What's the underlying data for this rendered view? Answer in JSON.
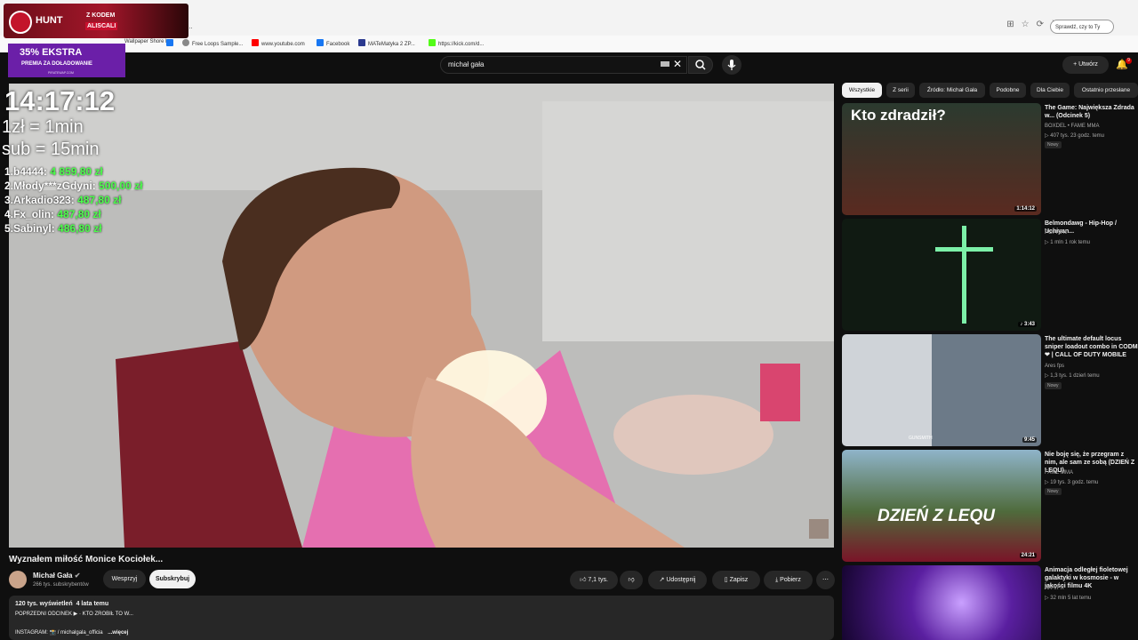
{
  "browser": {
    "address": "...",
    "search_label": "Sprawdź, czy to Ty",
    "bookmarks": [
      "Wallpaper Shore l...",
      "Free Loops Sample...",
      "www.youtube.com",
      "Facebook",
      "MATeMatyka 2 ZP...",
      "https://kick.com/d..."
    ]
  },
  "overlay": {
    "hunt_label": "HUNT",
    "hunt_code_prefix": "Z KODEM",
    "hunt_code": "ALISCALI",
    "promo_title": "35% EKSTRA",
    "promo_sub": "PREMIA ZA DOŁADOWANIE",
    "promo_url": "PIRATEWAP.COM",
    "clock": "14:17:12",
    "rate_1": "1zł = 1min",
    "rate_2": "sub = 15min",
    "leaderboard": [
      {
        "rank": "1.",
        "name": "b4444:",
        "amount": "4 859,80 zł"
      },
      {
        "rank": "2.",
        "name": "Młody***zGdyni:",
        "amount": "500,00 zł"
      },
      {
        "rank": "3.",
        "name": "Arkadio323:",
        "amount": "487,80 zł"
      },
      {
        "rank": "4.",
        "name": "Fx_olin:",
        "amount": "487,80 zł"
      },
      {
        "rank": "5.",
        "name": "Sabinyl:",
        "amount": "486,80 zł"
      }
    ]
  },
  "header": {
    "search_value": "michał gała",
    "create_label": "Utwórz",
    "notifications_badge": "9"
  },
  "video": {
    "title": "Wyznałem miłość Monice Kociołek...",
    "channel": "Michał Gała",
    "subscribers": "266 tys. subskrybentów",
    "support_label": "Wesprzyj",
    "subscribe_label": "Subskrybuj",
    "likes": "7,1 tys.",
    "share_label": "Udostępnij",
    "save_label": "Zapisz",
    "download_label": "Pobierz",
    "views": "120 tys. wyświetleń",
    "age": "4 lata temu",
    "desc_line": "POPRZEDNI ODCINEK ▶ · KTO ZROBIŁ TO W...",
    "instagram": "INSTAGRAM: 📸 / michalgala_officia",
    "more": "...więcej"
  },
  "chips": [
    "Wszystkie",
    "Z serii",
    "Źródło: Michał Gała",
    "Podobne",
    "Dla Ciebie",
    "Ostatnio przesłane"
  ],
  "recommendations": [
    {
      "title": "The Game: Największa Zdrada w... (Odcinek 5)",
      "channel": "BOXDEL • FAME MMA",
      "meta": "▷ 407 tys.  23 godz. temu",
      "badge": "Nowy",
      "duration": "1:14:12",
      "thumb_text": "Kto zdradził?"
    },
    {
      "title": "Belmondawg - Hip-Hop / Uchiyan...",
      "channel": "POPPYN",
      "meta": "▷ 1 mln  1 rok temu",
      "badge": "",
      "duration": "3:43",
      "thumb_text": ""
    },
    {
      "title": "The ultimate default locus sniper loadout combo in CODM ❤ | CALL OF DUTY MOBILE",
      "channel": "Ares fps",
      "meta": "▷ 1,3 tys.  1 dzień temu",
      "badge": "Nowy",
      "duration": "9:45",
      "thumb_text": "GUNSMITH"
    },
    {
      "title": "Nie boję się, że przegram z nim, ale sam ze sobą (DZIEŃ Z LEQU)",
      "channel": "FAME MMA",
      "meta": "▷ 19 tys.  3 godz. temu",
      "badge": "Nowy",
      "duration": "24:21",
      "thumb_text": "DZIEŃ Z LEQU"
    },
    {
      "title": "Animacja odległej fioletowej galaktyki w kosmosie - w jakości filmu 4K",
      "channel": "AA-VFX",
      "meta": "▷ 32 mln  5 lat temu",
      "badge": "",
      "duration": "",
      "thumb_text": ""
    }
  ]
}
